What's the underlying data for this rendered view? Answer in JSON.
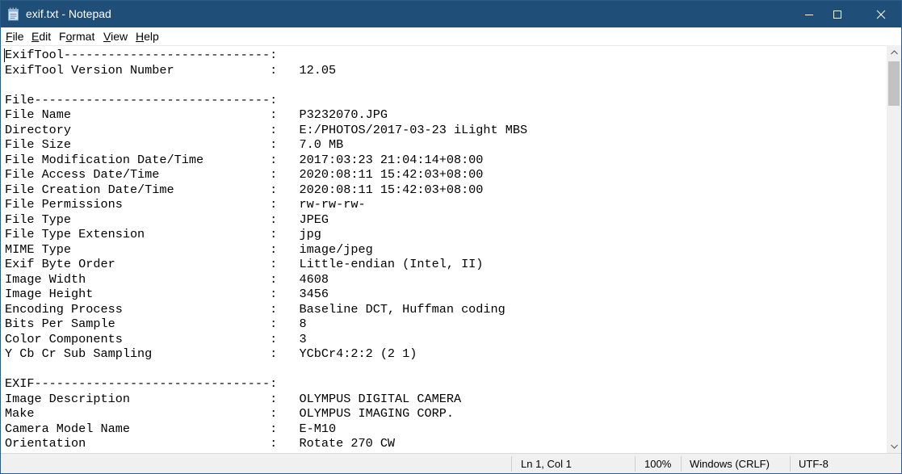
{
  "window": {
    "title": "exif.txt - Notepad",
    "icon": "notepad-icon",
    "colors": {
      "titlebar": "#1f4e79",
      "statusbar": "#f0f0f0"
    }
  },
  "menu": {
    "file": {
      "mnemonic": "F",
      "rest": "ile"
    },
    "edit": {
      "mnemonic": "E",
      "rest": "dit"
    },
    "format": {
      "pre": "F",
      "mnemonic": "o",
      "rest": "rmat"
    },
    "view": {
      "mnemonic": "V",
      "rest": "iew"
    },
    "help": {
      "mnemonic": "H",
      "rest": "elp"
    }
  },
  "editor": {
    "lines": [
      "ExifTool----------------------------:",
      "ExifTool Version Number             :   12.05",
      "",
      "File--------------------------------:",
      "File Name                           :   P3232070.JPG",
      "Directory                           :   E:/PHOTOS/2017-03-23 iLight MBS",
      "File Size                           :   7.0 MB",
      "File Modification Date/Time         :   2017:03:23 21:04:14+08:00",
      "File Access Date/Time               :   2020:08:11 15:42:03+08:00",
      "File Creation Date/Time             :   2020:08:11 15:42:03+08:00",
      "File Permissions                    :   rw-rw-rw-",
      "File Type                           :   JPEG",
      "File Type Extension                 :   jpg",
      "MIME Type                           :   image/jpeg",
      "Exif Byte Order                     :   Little-endian (Intel, II)",
      "Image Width                         :   4608",
      "Image Height                        :   3456",
      "Encoding Process                    :   Baseline DCT, Huffman coding",
      "Bits Per Sample                     :   8",
      "Color Components                    :   3",
      "Y Cb Cr Sub Sampling                :   YCbCr4:2:2 (2 1)",
      "",
      "EXIF--------------------------------:",
      "Image Description                   :   OLYMPUS DIGITAL CAMERA",
      "Make                                :   OLYMPUS IMAGING CORP.",
      "Camera Model Name                   :   E-M10",
      "Orientation                         :   Rotate 270 CW"
    ]
  },
  "status": {
    "position": "Ln 1, Col 1",
    "zoom": "100%",
    "line_ending": "Windows (CRLF)",
    "encoding": "UTF-8"
  }
}
